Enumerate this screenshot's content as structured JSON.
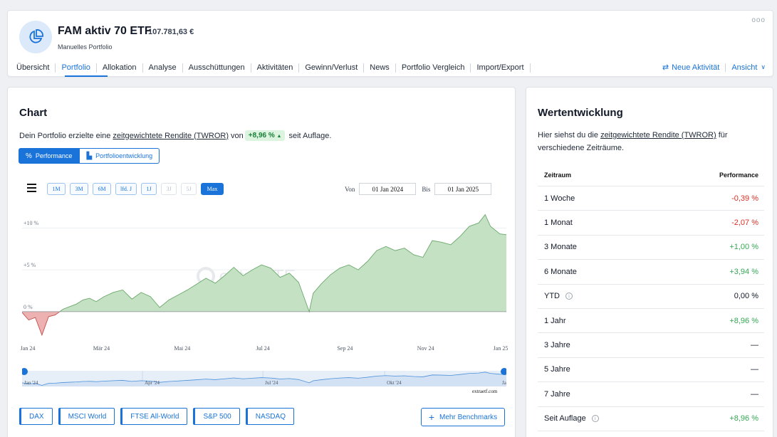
{
  "header": {
    "title": "FAM aktiv 70 ETF",
    "value": "107.781,63 €",
    "subtitle": "Manuelles Portfolio",
    "more": "ooo",
    "icon": "pie-chart-icon",
    "tabs": [
      {
        "label": "Übersicht"
      },
      {
        "label": "Portfolio",
        "active": true
      },
      {
        "label": "Allokation"
      },
      {
        "label": "Analyse"
      },
      {
        "label": "Ausschüttungen"
      },
      {
        "label": "Aktivitäten"
      },
      {
        "label": "Gewinn/Verlust"
      },
      {
        "label": "News"
      },
      {
        "label": "Portfolio Vergleich"
      },
      {
        "label": "Import/Export"
      }
    ],
    "new_activity": "Neue Aktivität",
    "view": "Ansicht"
  },
  "chart_section": {
    "title": "Chart",
    "desc_prefix": "Dein Portfolio erzielte eine",
    "desc_link": "zeitgewichtete Rendite (TWROR)",
    "desc_mid": "von",
    "return_value": "+8,96 %",
    "desc_suffix": "seit Auflage.",
    "toggle_performance": "Performance",
    "toggle_development": "Portfolioentwicklung",
    "ranges": [
      {
        "label": "1M",
        "state": "normal",
        "w": 26
      },
      {
        "label": "3M",
        "state": "normal",
        "w": 26
      },
      {
        "label": "6M",
        "state": "normal",
        "w": 26
      },
      {
        "label": "lfd. J",
        "state": "normal",
        "w": 30
      },
      {
        "label": "1J",
        "state": "normal",
        "w": 22
      },
      {
        "label": "3J",
        "state": "disabled",
        "w": 22
      },
      {
        "label": "5J",
        "state": "disabled",
        "w": 22
      },
      {
        "label": "Max",
        "state": "selected",
        "w": 32
      }
    ],
    "from_label": "Von",
    "from_date": "01 Jan 2024",
    "to_label": "Bis",
    "to_date": "01 Jan 2025",
    "watermark": "extraETF",
    "credit": "extraetf.com",
    "benchmarks": [
      "DAX",
      "MSCI World",
      "FTSE All-World",
      "S&P 500",
      "NASDAQ"
    ],
    "more_benchmarks": "Mehr Benchmarks",
    "navigator_labels": [
      "Jan '24",
      "Apr '24",
      "Jul '24",
      "Okt '24",
      "Ja"
    ]
  },
  "chart_data": {
    "type": "area",
    "title": "",
    "xlabel": "",
    "ylabel": "",
    "x_ticks": [
      "Jan 24",
      "Mär 24",
      "Mai 24",
      "Jul 24",
      "Sep 24",
      "Nov 24",
      "Jan 25"
    ],
    "y_ticks": [
      "+10 %",
      "+5 %",
      "0 %"
    ],
    "ylim": [
      -3.5,
      12.5
    ],
    "grid": true,
    "colors": {
      "positive_fill": "#c4e1c4",
      "positive_line": "#6aa96a",
      "negative_fill": "#eeb1b1",
      "negative_line": "#c0504d"
    },
    "series": [
      {
        "x": [
          "2024-01-01",
          "2024-01-06",
          "2024-01-11",
          "2024-01-16",
          "2024-01-21",
          "2024-01-26",
          "2024-02-01",
          "2024-02-06",
          "2024-02-11",
          "2024-02-16",
          "2024-02-21",
          "2024-02-26",
          "2024-03-03",
          "2024-03-10",
          "2024-03-17",
          "2024-03-24",
          "2024-03-31",
          "2024-04-07",
          "2024-04-14",
          "2024-04-21",
          "2024-04-28",
          "2024-05-05",
          "2024-05-12",
          "2024-05-19",
          "2024-05-26",
          "2024-06-02",
          "2024-06-09",
          "2024-06-16",
          "2024-06-23",
          "2024-06-30",
          "2024-07-07",
          "2024-07-14",
          "2024-07-21",
          "2024-07-28",
          "2024-08-05",
          "2024-08-08",
          "2024-08-14",
          "2024-08-21",
          "2024-08-28",
          "2024-09-04",
          "2024-09-11",
          "2024-09-18",
          "2024-09-25",
          "2024-10-02",
          "2024-10-09",
          "2024-10-16",
          "2024-10-23",
          "2024-10-30",
          "2024-11-06",
          "2024-11-13",
          "2024-11-20",
          "2024-11-27",
          "2024-12-04",
          "2024-12-11",
          "2024-12-16",
          "2024-12-20",
          "2024-12-27",
          "2025-01-01"
        ],
        "values": [
          -0.1,
          -1.0,
          -0.7,
          -2.8,
          -0.6,
          -0.4,
          0.3,
          0.6,
          0.9,
          1.4,
          1.6,
          1.2,
          1.8,
          2.3,
          2.6,
          1.5,
          2.3,
          1.8,
          0.5,
          1.4,
          2.0,
          2.6,
          3.3,
          4.0,
          3.4,
          4.3,
          5.3,
          4.3,
          5.0,
          5.6,
          5.2,
          4.1,
          4.6,
          3.5,
          0.0,
          2.2,
          3.3,
          4.4,
          5.2,
          5.6,
          5.0,
          6.0,
          7.3,
          7.8,
          7.3,
          7.6,
          6.8,
          6.5,
          8.5,
          8.3,
          8.0,
          9.0,
          10.2,
          10.6,
          11.6,
          10.2,
          9.3,
          9.2
        ]
      }
    ]
  },
  "performance": {
    "title": "Wertentwicklung",
    "desc_prefix": "Hier siehst du die",
    "desc_link": "zeitgewichtete Rendite (TWROR)",
    "desc_suffix": "für verschiedene Zeiträume.",
    "col_period": "Zeitraum",
    "col_performance": "Performance",
    "rows": [
      {
        "period": "1 Woche",
        "value": "-0,39 %",
        "tone": "neg"
      },
      {
        "period": "1 Monat",
        "value": "-2,07 %",
        "tone": "neg"
      },
      {
        "period": "3 Monate",
        "value": "+1,00 %",
        "tone": "pos"
      },
      {
        "period": "6 Monate",
        "value": "+3,94 %",
        "tone": "pos"
      },
      {
        "period": "YTD",
        "value": "0,00 %",
        "tone": "neutral",
        "info": true
      },
      {
        "period": "1 Jahr",
        "value": "+8,96 %",
        "tone": "pos"
      },
      {
        "period": "3 Jahre",
        "value": "—",
        "tone": "neutral"
      },
      {
        "period": "5 Jahre",
        "value": "—",
        "tone": "neutral"
      },
      {
        "period": "7 Jahre",
        "value": "—",
        "tone": "neutral"
      },
      {
        "period": "Seit Auflage",
        "value": "+8,96 %",
        "tone": "pos",
        "info": true
      }
    ]
  }
}
